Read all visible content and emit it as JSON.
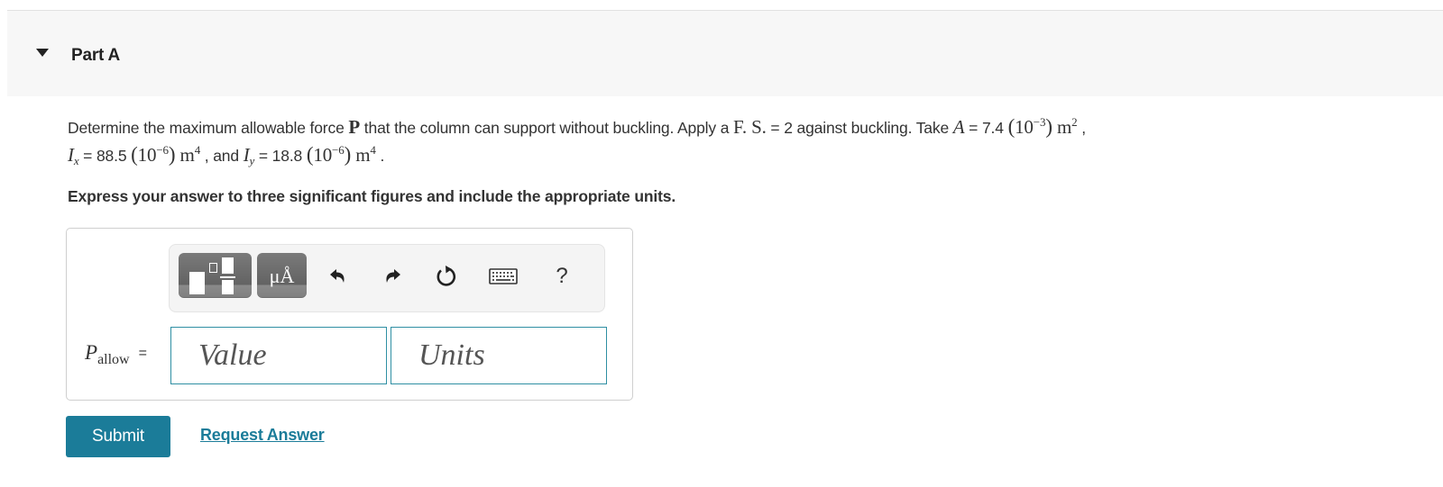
{
  "part": {
    "title": "Part A",
    "toggle_icon": "caret-down-icon"
  },
  "question": {
    "intro": "Determine the maximum allowable force ",
    "force_symbol": "P",
    "mid1": " that the column can support without buckling. Apply a ",
    "fs_symbol": "F. S.",
    "fs_value": " = 2 against buckling. Take ",
    "A_symbol": "A",
    "A_value": " = 7.4 ",
    "A_exp_base": "10",
    "A_exp": "−3",
    "A_unit": "m",
    "A_unit_exp": "2",
    "sep1": " ,",
    "Ix_symbol": "I",
    "Ix_sub": "x",
    "Ix_value": " = 88.5 ",
    "Ix_exp_base": "10",
    "Ix_exp": "−6",
    "Ix_unit": "m",
    "Ix_unit_exp": "4",
    "sep2": " , and ",
    "Iy_symbol": "I",
    "Iy_sub": "y",
    "Iy_value": " = 18.8 ",
    "Iy_exp_base": "10",
    "Iy_exp": "−6",
    "Iy_unit": "m",
    "Iy_unit_exp": "4",
    "end": " ."
  },
  "instruction": "Express your answer to three significant figures and include the appropriate units.",
  "toolbar": {
    "template_icon": "templates-icon",
    "units_label": "μÅ",
    "undo_icon": "undo-icon",
    "redo_icon": "redo-icon",
    "reset_icon": "reset-icon",
    "keyboard_icon": "keyboard-icon",
    "help_label": "?"
  },
  "answer": {
    "variable": "P",
    "variable_sub": "allow",
    "equals": "=",
    "value_placeholder": "Value",
    "value": "",
    "units_placeholder": "Units",
    "units": ""
  },
  "actions": {
    "submit_label": "Submit",
    "request_answer_label": "Request Answer"
  },
  "colors": {
    "accent": "#1b7c99",
    "input_border": "#2f8fa3",
    "header_bg": "#f7f7f7"
  }
}
